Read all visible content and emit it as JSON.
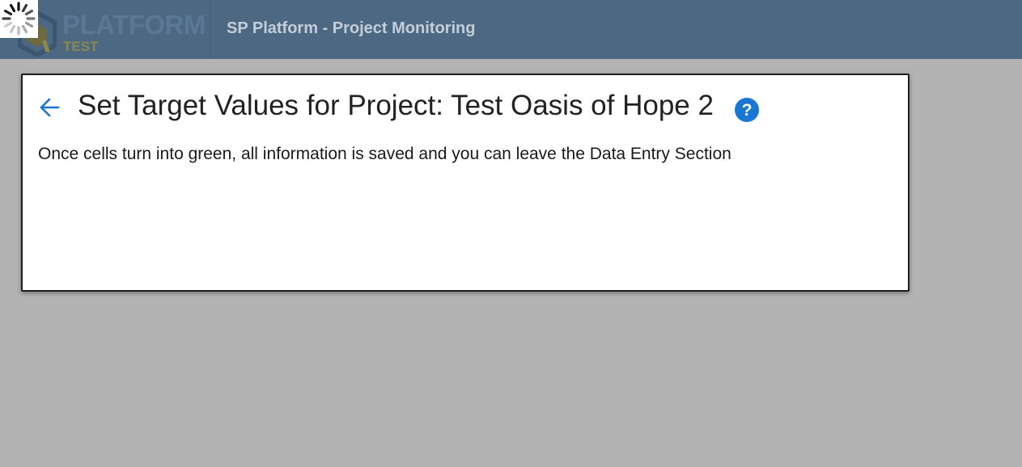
{
  "header": {
    "logo_word": "PLATFORM",
    "logo_sub": "TEST",
    "app_title": "SP Platform - Project Monitoring"
  },
  "card": {
    "title": "Set Target Values for Project: Test Oasis of Hope 2",
    "description": "Once cells turn into green, all information is saved and you can leave the Data Entry Section",
    "back_icon": "arrow-left-icon",
    "help_icon": "question-circle-icon"
  },
  "colors": {
    "topbar": "#4c6882",
    "overlay": "#b3b3b3",
    "accent": "#1976d2"
  }
}
